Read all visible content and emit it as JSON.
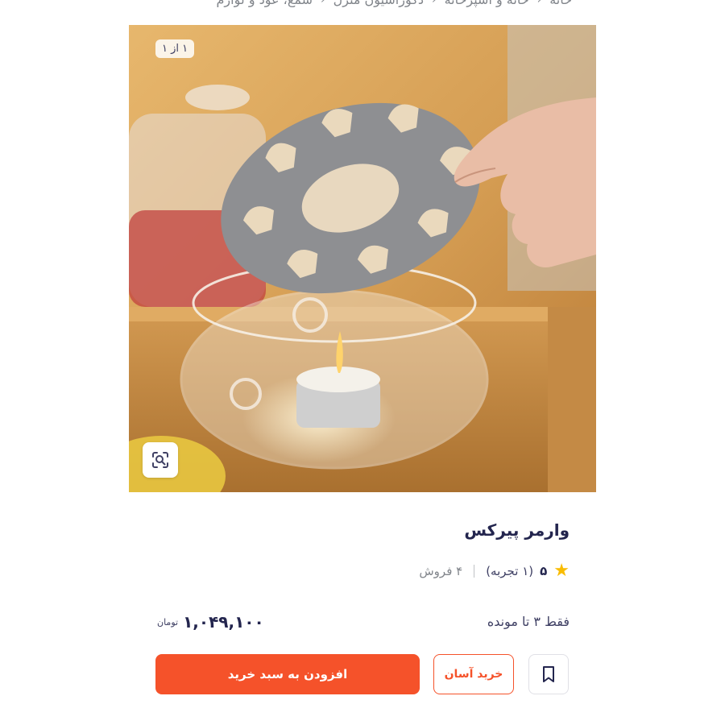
{
  "breadcrumb": {
    "items": [
      "خانه",
      "خانه و آشپزخانه",
      "دکوراسیون منزل",
      "شمع، عود و لوازم"
    ]
  },
  "gallery": {
    "counter": "۱ از ۱"
  },
  "product": {
    "title": "وارمر پیرکس",
    "rating_score": "۵",
    "rating_count": "(۱ تجربه)",
    "sales": "۴ فروش",
    "stock_text": "فقط ۳ تا مونده",
    "price": "۱,۰۴۹,۱۰۰",
    "currency": "تومان"
  },
  "actions": {
    "add_to_cart": "افزودن به سبد خرید",
    "easy_buy": "خرید آسان"
  },
  "icons": {
    "star": "star-icon",
    "zoom": "image-search-icon",
    "bookmark": "bookmark-icon",
    "chevron": "chevron-left-icon"
  },
  "colors": {
    "accent": "#f5522a",
    "star": "#f9bc00"
  }
}
